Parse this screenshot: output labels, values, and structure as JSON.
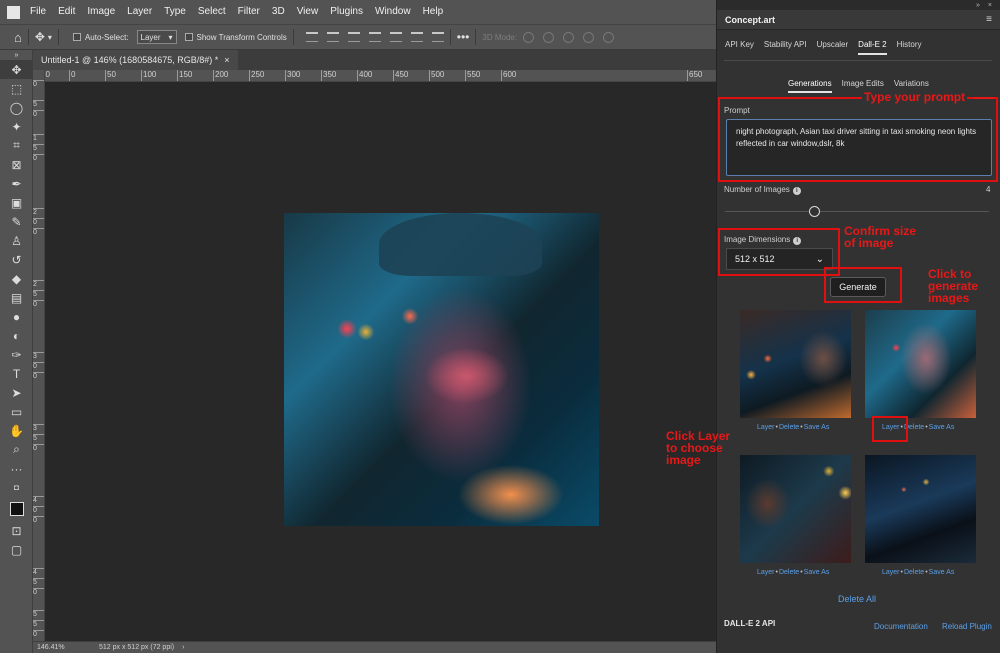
{
  "menubar": {
    "items": [
      "File",
      "Edit",
      "Image",
      "Layer",
      "Type",
      "Select",
      "Filter",
      "3D",
      "View",
      "Plugins",
      "Window",
      "Help"
    ]
  },
  "options": {
    "auto_select": "Auto-Select:",
    "layer_value": "Layer",
    "show_transform": "Show Transform Controls",
    "mode_label": "3D Mode:"
  },
  "document": {
    "tab_title": "Untitled-1 @ 146% (1680584675, RGB/8#) *",
    "ruler_top": [
      "50",
      "0",
      "50",
      "100",
      "150",
      "200",
      "250",
      "300",
      "350",
      "400",
      "450",
      "500",
      "550",
      "600",
      "650"
    ],
    "ruler_left": [
      "0",
      "5",
      "0",
      "1",
      "5",
      "0",
      "2",
      "0",
      "0",
      "2",
      "5",
      "0",
      "3",
      "0",
      "0",
      "3",
      "5",
      "0",
      "4",
      "0",
      "0",
      "4",
      "5",
      "0",
      "5",
      "5",
      "0"
    ],
    "zoom": "146.41%",
    "size_info": "512 px x 512 px (72 ppi)"
  },
  "panel": {
    "title": "Concept.art",
    "tabs": [
      "API Key",
      "Stability API",
      "Upscaler",
      "Dall-E 2",
      "History"
    ],
    "active_tab": "Dall-E 2",
    "subtabs": [
      "Generations",
      "Image Edits",
      "Variations"
    ],
    "active_subtab": "Generations",
    "prompt_label": "Prompt",
    "prompt_text": "night photograph, Asian taxi driver sitting in taxi smoking neon lights reflected in car window,dslr, 8k",
    "num_images_label": "Number of Images",
    "num_images_value": "4",
    "dimensions_label": "Image Dimensions",
    "dimensions_value": "512 x 512",
    "generate_label": "Generate",
    "thumb_actions": {
      "layer": "Layer",
      "delete": "Delete",
      "save": "Save As"
    },
    "delete_all": "Delete All",
    "footer_api": "DALL-E 2 API",
    "documentation": "Documentation",
    "reload": "Reload Plugin"
  },
  "annotations": {
    "type_prompt": "Type your prompt",
    "confirm_size": [
      "Confirm size",
      "of image"
    ],
    "click_generate": [
      "Click to",
      "generate",
      "images"
    ],
    "click_layer": [
      "Click Layer",
      "to choose",
      "image"
    ]
  },
  "colors": {
    "accent_link": "#5aa0e8",
    "annotation_red": "#e01010"
  }
}
